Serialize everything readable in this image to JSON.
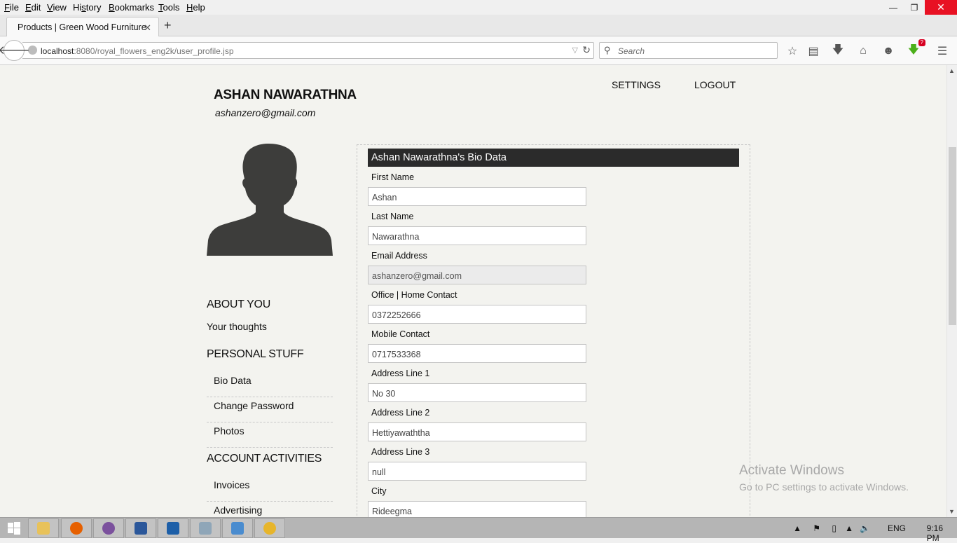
{
  "browser": {
    "menu": [
      "File",
      "Edit",
      "View",
      "History",
      "Bookmarks",
      "Tools",
      "Help"
    ],
    "tab_title": "Products | Green Wood Furniture",
    "url_host": "localhost",
    "url_rest": ":8080/royal_flowers_eng2k/user_profile.jsp",
    "search_placeholder": "Search",
    "download_badge": "?"
  },
  "header": {
    "name": "ASHAN NAWARATHNA",
    "email": "ashanzero@gmail.com",
    "settings": "SETTINGS",
    "logout": "LOGOUT"
  },
  "sidebar": {
    "about_heading": "ABOUT YOU",
    "about_item": "Your thoughts",
    "personal_heading": "PERSONAL STUFF",
    "personal_items": [
      "Bio Data",
      "Change Password",
      "Photos"
    ],
    "account_heading": "ACCOUNT ACTIVITIES",
    "account_items": [
      "Invoices",
      "Advertising"
    ]
  },
  "biodata": {
    "title": "Ashan Nawarathna's Bio Data",
    "fields": [
      {
        "label": "First Name",
        "value": "Ashan"
      },
      {
        "label": "Last Name",
        "value": "Nawarathna"
      },
      {
        "label": "Email Address",
        "value": "ashanzero@gmail.com"
      },
      {
        "label": "Office | Home Contact",
        "value": "0372252666"
      },
      {
        "label": "Mobile Contact",
        "value": "0717533368"
      },
      {
        "label": "Address Line 1",
        "value": "No 30"
      },
      {
        "label": "Address Line 2",
        "value": "Hettiyawaththa"
      },
      {
        "label": "Address Line 3",
        "value": "null"
      },
      {
        "label": "City",
        "value": "Rideegma"
      }
    ]
  },
  "watermark": {
    "line1": "Activate Windows",
    "line2": "Go to PC settings to activate Windows."
  },
  "taskbar": {
    "lang": "ENG",
    "time": "9:16 PM"
  },
  "colors": {
    "panel_title_bg": "#2b2b2b",
    "page_bg": "#f3f3ef",
    "close_button": "#e81123"
  }
}
